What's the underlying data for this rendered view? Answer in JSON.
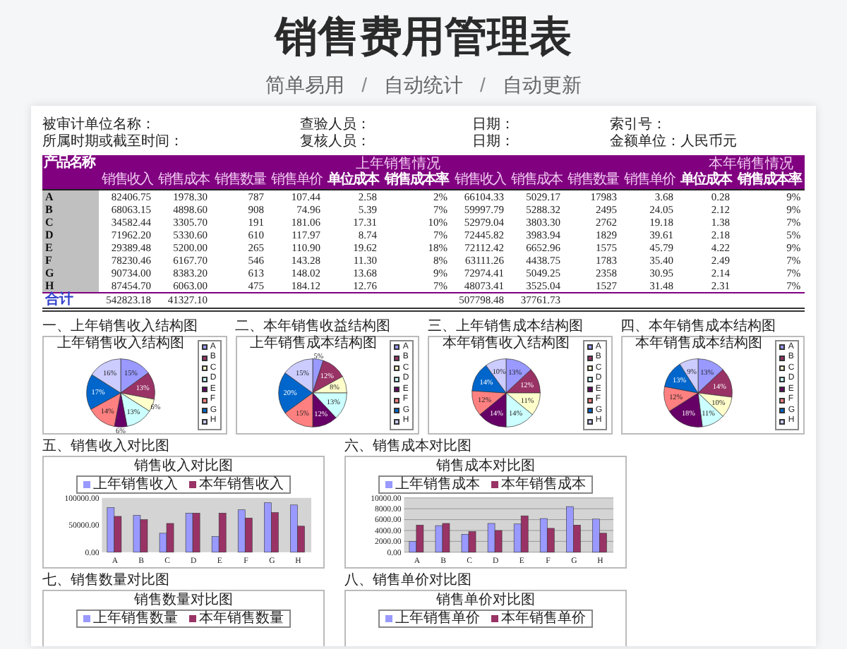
{
  "title": "销售费用管理表",
  "subtitle": {
    "items": [
      "简单易用",
      "自动统计",
      "自动更新"
    ],
    "separator": "/"
  },
  "sheet": {
    "info_rows": [
      [
        "被审计单位名称：",
        "查验人员：",
        "日期：",
        "索引号："
      ],
      [
        "所属时期或截至时间：",
        "复核人员：",
        "日期：",
        "金额单位：人民币元"
      ]
    ],
    "first_header": "产品名称",
    "groups": [
      {
        "label": "上年销售情况",
        "columns": [
          {
            "label": "销售收入",
            "bold": false
          },
          {
            "label": "销售成本",
            "bold": false
          },
          {
            "label": "销售数量",
            "bold": false
          },
          {
            "label": "销售单价",
            "bold": false
          },
          {
            "label": "单位成本",
            "bold": true
          },
          {
            "label": "销售成本率",
            "bold": true
          }
        ]
      },
      {
        "label": "本年销售情况",
        "columns": [
          {
            "label": "销售收入",
            "bold": false
          },
          {
            "label": "销售成本",
            "bold": false
          },
          {
            "label": "销售数量",
            "bold": false
          },
          {
            "label": "销售单价",
            "bold": false
          },
          {
            "label": "单位成本",
            "bold": true
          },
          {
            "label": "销售成本率",
            "bold": true
          }
        ]
      }
    ],
    "rows": [
      {
        "name": "A",
        "cells": [
          "82406.75",
          "1978.30",
          "787",
          "107.44",
          "2.58",
          "2%",
          "66104.33",
          "5029.17",
          "17983",
          "3.68",
          "0.28",
          "9%"
        ]
      },
      {
        "name": "B",
        "cells": [
          "68063.15",
          "4898.60",
          "908",
          "74.96",
          "5.39",
          "7%",
          "59997.79",
          "5288.32",
          "2495",
          "24.05",
          "2.12",
          "9%"
        ]
      },
      {
        "name": "C",
        "cells": [
          "34582.44",
          "3305.70",
          "191",
          "181.06",
          "17.31",
          "10%",
          "52979.04",
          "3803.30",
          "2762",
          "19.18",
          "1.38",
          "7%"
        ]
      },
      {
        "name": "D",
        "cells": [
          "71962.20",
          "5330.60",
          "610",
          "117.97",
          "8.74",
          "7%",
          "72445.82",
          "3983.94",
          "1829",
          "39.61",
          "2.18",
          "5%"
        ]
      },
      {
        "name": "E",
        "cells": [
          "29389.48",
          "5200.00",
          "265",
          "110.90",
          "19.62",
          "18%",
          "72112.42",
          "6652.96",
          "1575",
          "45.79",
          "4.22",
          "9%"
        ]
      },
      {
        "name": "F",
        "cells": [
          "78230.46",
          "6167.70",
          "546",
          "143.28",
          "11.30",
          "8%",
          "63111.26",
          "4438.75",
          "1783",
          "35.40",
          "2.49",
          "7%"
        ]
      },
      {
        "name": "G",
        "cells": [
          "90734.00",
          "8383.20",
          "613",
          "148.02",
          "13.68",
          "9%",
          "72974.41",
          "5049.25",
          "2358",
          "30.95",
          "2.14",
          "7%"
        ]
      },
      {
        "name": "H",
        "cells": [
          "87454.70",
          "6063.00",
          "475",
          "184.12",
          "12.76",
          "7%",
          "48073.41",
          "3525.04",
          "1527",
          "31.48",
          "2.31",
          "7%"
        ]
      }
    ],
    "total": {
      "label": "合计",
      "last_year": [
        "542823.18",
        "41327.10"
      ],
      "this_year": [
        "507798.48",
        "37761.73"
      ]
    }
  },
  "pie_charts": [
    {
      "section": "一、上年销售收入结构图",
      "chart_data": {
        "type": "pie",
        "title": "上年销售收入结构图",
        "categories": [
          "A",
          "B",
          "C",
          "D",
          "E",
          "F",
          "G",
          "H"
        ],
        "legend": "right",
        "series": [
          {
            "values": [
              15,
              13,
              6,
              13,
              6,
              14,
              17,
              16
            ]
          }
        ],
        "value_labels": [
          "15%",
          "13%",
          "6%",
          "13%",
          "6%",
          "14%",
          "17%",
          "16%"
        ]
      }
    },
    {
      "section": "二、本年销售收益结构图",
      "chart_data": {
        "type": "pie",
        "title": "上年销售成本结构图",
        "categories": [
          "A",
          "B",
          "C",
          "D",
          "E",
          "F",
          "G",
          "H"
        ],
        "legend": "right",
        "series": [
          {
            "values": [
              5,
              12,
              8,
              13,
              12,
              15,
              20,
              15
            ]
          }
        ],
        "value_labels": [
          "5%",
          "12%",
          "8%",
          "13%",
          "12%",
          "15%",
          "20%",
          "15%"
        ]
      }
    },
    {
      "section": "三、上年销售成本结构图",
      "chart_data": {
        "type": "pie",
        "title": "本年销售收入结构图",
        "categories": [
          "A",
          "B",
          "C",
          "D",
          "E",
          "F",
          "G",
          "H"
        ],
        "legend": "right",
        "series": [
          {
            "values": [
              13,
              12,
              11,
              14,
              14,
              12,
              14,
              10
            ]
          }
        ],
        "value_labels": [
          "13%",
          "12%",
          "11%",
          "14%",
          "14%",
          "12%",
          "14%",
          "10%"
        ]
      }
    },
    {
      "section": "四、本年销售成本结构图",
      "chart_data": {
        "type": "pie",
        "title": "本年销售成本结构图",
        "categories": [
          "A",
          "B",
          "C",
          "D",
          "E",
          "F",
          "G",
          "H"
        ],
        "legend": "right",
        "series": [
          {
            "values": [
              13,
              14,
              10,
              11,
              18,
              12,
              13,
              9
            ]
          }
        ],
        "value_labels": [
          "13%",
          "14%",
          "10%",
          "11%",
          "18%",
          "12%",
          "13%",
          "9%"
        ]
      }
    }
  ],
  "bar_charts": [
    {
      "section": "五、销售收入对比图",
      "chart_data": {
        "type": "bar",
        "title": "销售收入对比图",
        "categories": [
          "A",
          "B",
          "C",
          "D",
          "E",
          "F",
          "G",
          "H"
        ],
        "legend": "top",
        "grid": false,
        "series": [
          {
            "name": "上年销售收入",
            "color": "#9999ff",
            "values": [
              82000,
              68000,
              35000,
              72000,
              29000,
              78000,
              91000,
              87000
            ]
          },
          {
            "name": "本年销售收入",
            "color": "#993366",
            "values": [
              66000,
              60000,
              53000,
              72000,
              72000,
              63000,
              73000,
              48000
            ]
          }
        ],
        "ylim": [
          0,
          100000
        ],
        "yticks": [
          {
            "value": 0,
            "label": "0.00"
          },
          {
            "value": 50000,
            "label": "50000.00"
          },
          {
            "value": 100000,
            "label": "100000.00"
          }
        ]
      }
    },
    {
      "section": "六、销售成本对比图",
      "chart_data": {
        "type": "bar",
        "title": "销售成本对比图",
        "categories": [
          "A",
          "B",
          "C",
          "D",
          "E",
          "F",
          "G",
          "H"
        ],
        "legend": "top",
        "grid": true,
        "series": [
          {
            "name": "上年销售成本",
            "color": "#9999ff",
            "values": [
              2000,
              4900,
              3300,
              5300,
              5200,
              6200,
              8400,
              6100
            ]
          },
          {
            "name": "本年销售成本",
            "color": "#993366",
            "values": [
              5000,
              5300,
              3800,
              4000,
              6700,
              4400,
              5000,
              3500
            ]
          }
        ],
        "ylim": [
          0,
          10000
        ],
        "yticks": [
          {
            "value": 0,
            "label": "0.00"
          },
          {
            "value": 2000,
            "label": "2000.00"
          },
          {
            "value": 4000,
            "label": "4000.00"
          },
          {
            "value": 6000,
            "label": "6000.00"
          },
          {
            "value": 8000,
            "label": "8000.00"
          },
          {
            "value": 10000,
            "label": "10000.00"
          }
        ]
      }
    }
  ],
  "cut_charts": [
    {
      "section": "七、销售数量对比图",
      "title": "销售数量对比图",
      "legend": [
        {
          "label": "上年销售数量",
          "color": "#9999ff"
        },
        {
          "label": "本年销售数量",
          "color": "#993366"
        }
      ]
    },
    {
      "section": "八、销售单价对比图",
      "title": "销售单价对比图",
      "legend": [
        {
          "label": "上年销售单价",
          "color": "#9999ff"
        },
        {
          "label": "本年销售单价",
          "color": "#993366"
        }
      ]
    }
  ]
}
